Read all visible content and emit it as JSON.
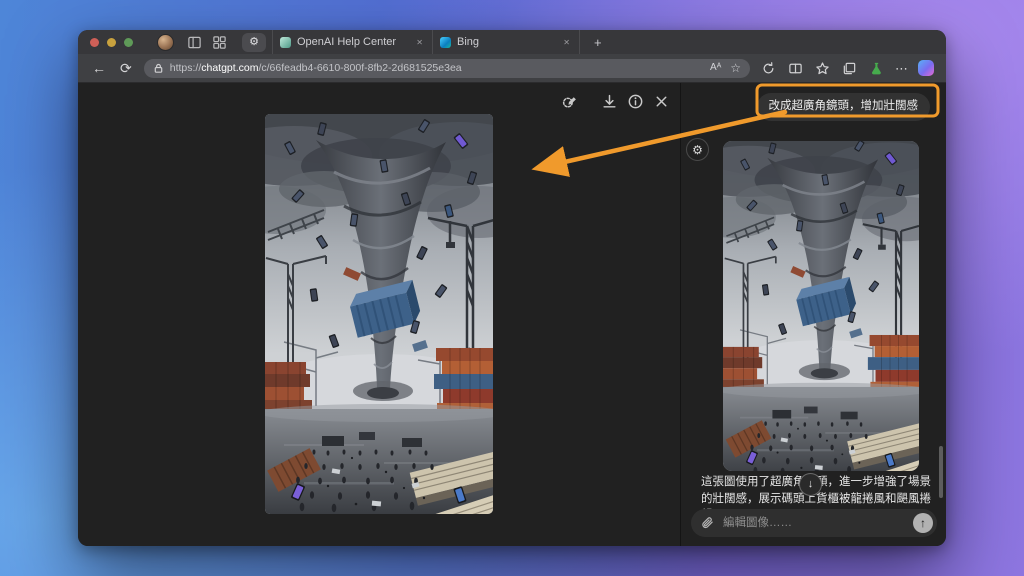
{
  "colors": {
    "annotation": "#f09a2c",
    "traffic-red": "#ce5f57",
    "traffic-yellow": "#c9a23e",
    "traffic-green": "#5f9a58"
  },
  "glyphs": {
    "back": "←",
    "refresh": "⟳",
    "new_tab": "+",
    "close_tab": "✕",
    "text_size": "Aᴬ",
    "favorite_star": "☆",
    "more": "⋯",
    "gear": "⚙",
    "scroll_down": "↓",
    "send": "↑"
  },
  "tabs": [
    {
      "label": "OpenAI Help Center"
    },
    {
      "label": "Bing"
    }
  ],
  "address": {
    "scheme": "https://",
    "domain": "chatgpt.com",
    "path": "/c/66feadb4-6610-800f-8fb2-2d681525e3ea"
  },
  "chat": {
    "prompt": "改成超廣角鏡頭，增加壯闊感",
    "response": "這張圖使用了超廣角鏡頭，進一步增強了場景的壯闊感，展示碼頭上貨櫃被龍捲風和颶風捲起，",
    "input_placeholder": "編輯圖像……"
  }
}
